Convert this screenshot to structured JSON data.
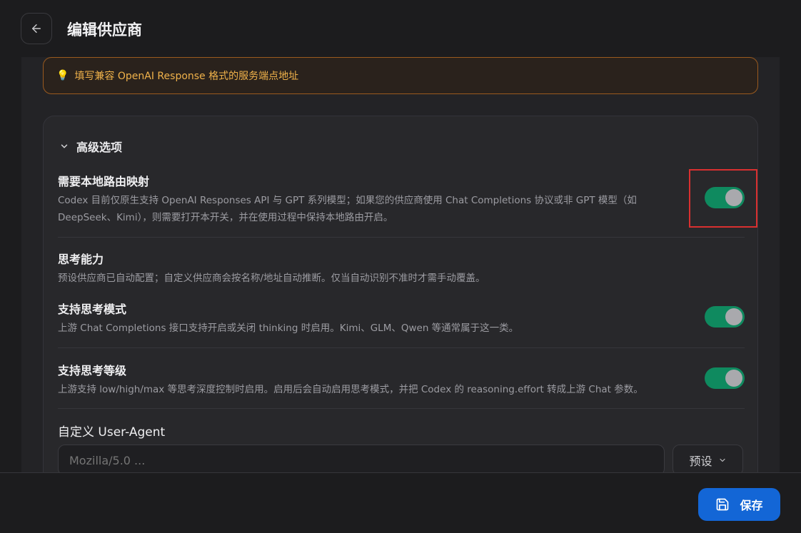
{
  "header": {
    "title": "编辑供应商"
  },
  "notice": {
    "text": "填写兼容 OpenAI Response 格式的服务端点地址"
  },
  "advanced": {
    "heading": "高级选项",
    "local_routing": {
      "title": "需要本地路由映射",
      "desc_line1": "Codex 目前仅原生支持 OpenAI Responses API 与 GPT 系列模型；如果您的供应商使用 Chat Completions 协议或非 GPT 模型（如",
      "desc_line2": "DeepSeek、Kimi），则需要打开本开关，并在使用过程中保持本地路由开启。",
      "enabled": true
    },
    "thinking": {
      "title": "思考能力",
      "desc": "预设供应商已自动配置；自定义供应商会按名称/地址自动推断。仅当自动识别不准时才需手动覆盖。"
    },
    "thinking_mode": {
      "title": "支持思考模式",
      "desc": "上游 Chat Completions 接口支持开启或关闭 thinking 时启用。Kimi、GLM、Qwen 等通常属于这一类。",
      "enabled": true
    },
    "thinking_level": {
      "title": "支持思考等级",
      "desc": "上游支持 low/high/max 等思考深度控制时启用。启用后会自动启用思考模式，并把 Codex 的 reasoning.effort 转成上游 Chat 参数。",
      "enabled": true
    },
    "user_agent": {
      "title": "自定义 User-Agent",
      "placeholder": "Mozilla/5.0 ...",
      "preset_label": "预设"
    }
  },
  "footer": {
    "save_label": "保存"
  },
  "colors": {
    "accent": "#1366d6",
    "toggle_on": "#0f8a5f",
    "warning": "#f0b24a",
    "highlight": "#d93030"
  }
}
